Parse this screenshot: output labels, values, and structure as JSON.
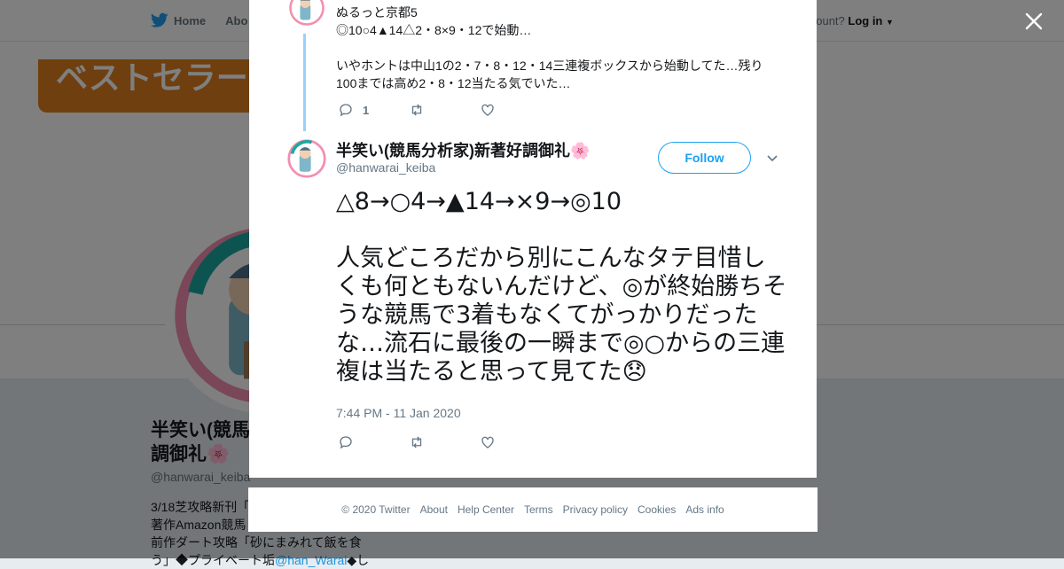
{
  "topbar": {
    "home_label": "Home",
    "about_label": "Abo",
    "login_prefix": "account?",
    "login_label": "Log in"
  },
  "banner": {
    "orange_text": "ベストセラー"
  },
  "profile": {
    "name_line1": "半笑い(競馬",
    "name_line2": "調御礼",
    "handle": "@hanwarai_keiba",
    "bio_line1": "3/18芝攻略新刊「",
    "bio_line2": "著作Amazon競馬",
    "bio_line3": "前作ダート攻略「砂にまみれて飯を食",
    "bio_line4_prefix": "う」◆プライベート垢",
    "bio_link": "@han_Warai",
    "bio_line4_suffix": "◆し"
  },
  "reply_tweet": {
    "author": "ぬるっと京都5",
    "text": "◎10○4▲14△2・8×9・12で始動…\n\nいやホントは中山1の2・7・8・12・14三連複ボックスから始動してた…残り100までは高め2・8・12当たる気でいた…",
    "reply_count": "1",
    "retweet_count": "",
    "like_count": ""
  },
  "main_tweet": {
    "name": "半笑い(競馬分析家)新著好調御礼",
    "handle": "@hanwarai_keiba",
    "follow_label": "Follow",
    "text": "△8→○4→▲14→×9→◎10\n\n人気どころだから別にこんなタテ目惜しくも何ともないんだけど、◎が終始勝ちそうな競馬で3着もなくてがっかりだったな…流石に最後の一瞬まで◎○からの三連複は当たると思って見てた",
    "timestamp": "7:44 PM - 11 Jan 2020"
  },
  "footer": {
    "copyright": "© 2020 Twitter",
    "about": "About",
    "help": "Help Center",
    "terms": "Terms",
    "privacy": "Privacy policy",
    "cookies": "Cookies",
    "ads": "Ads info"
  },
  "colors": {
    "accent": "#1da1f2",
    "overlay": "rgba(0,0,0,0.5)",
    "thread_line": "#9ad0f5"
  },
  "icons": [
    "twitter-bird-icon",
    "close-icon",
    "reply-icon",
    "retweet-icon",
    "like-icon",
    "chevron-down-icon",
    "cherry-blossom-icon",
    "disappointed-face-icon"
  ]
}
